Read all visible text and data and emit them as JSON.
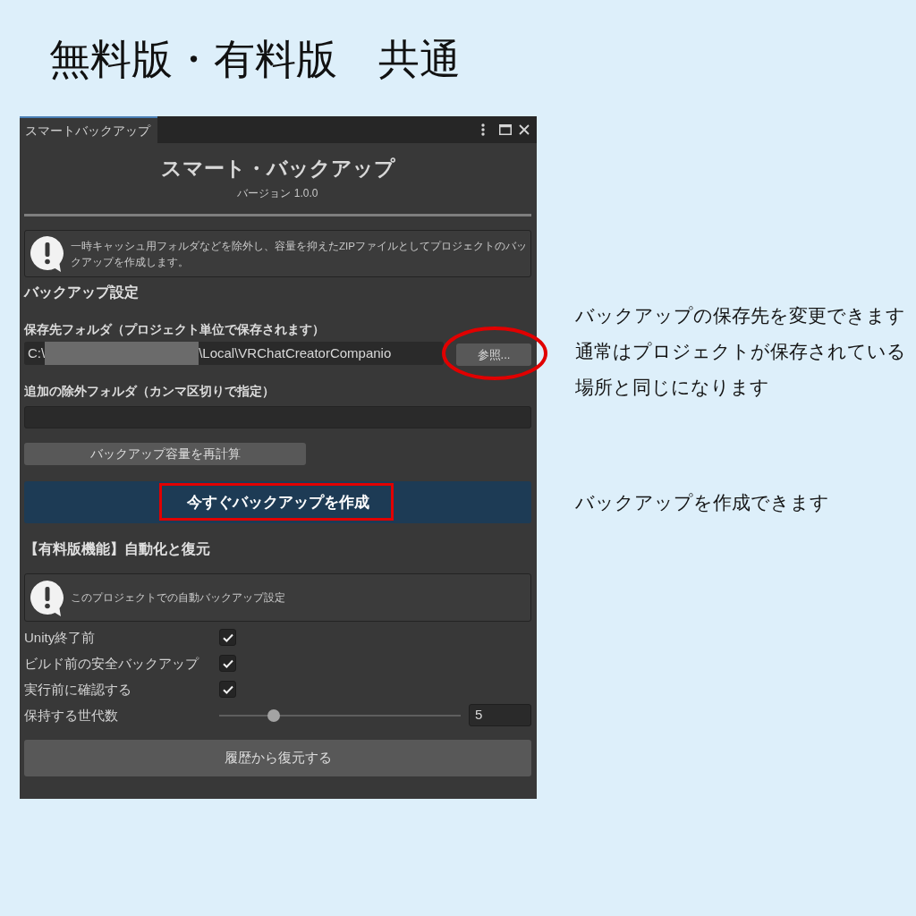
{
  "heading": "無料版・有料版　共通",
  "window": {
    "tabs": [
      {
        "label": "スマートバックアップ",
        "selected": true
      }
    ],
    "title": "スマート・バックアップ",
    "version": "バージョン 1.0.0"
  },
  "intro_notice": "一時キャッシュ用フォルダなどを除外し、容量を抑えたZIPファイルとしてプロジェクトのバックアップを作成します。",
  "backup_settings": {
    "heading": "バックアップ設定",
    "folder_label": "保存先フォルダ（プロジェクト単位で保存されます）",
    "folder_path": {
      "prefix": "C:\\",
      "redacted": true,
      "suffix": "\\Local\\VRChatCreatorCompanio"
    },
    "browse_button": {
      "label": "参照...",
      "circled": true
    },
    "exclude_label": "追加の除外フォルダ（カンマ区切りで指定）",
    "recalc_button": {
      "label": "バックアップ容量を再計算"
    },
    "create_button": {
      "label": "今すぐバックアップを作成",
      "boxed": true
    }
  },
  "pro_features": {
    "heading": "【有料版機能】自動化と復元",
    "notice": "このプロジェクトでの自動バックアップ設定",
    "options": [
      {
        "kind": "checkbox",
        "label": "Unity終了前",
        "checked": true
      },
      {
        "kind": "checkbox",
        "label": "ビルド前の安全バックアップ",
        "checked": true
      },
      {
        "kind": "checkbox",
        "label": "実行前に確認する",
        "checked": true
      },
      {
        "kind": "slider",
        "label": "保持する世代数",
        "level": 0.21,
        "value": "5"
      }
    ],
    "restore_button": {
      "label": "履歴から復元する"
    }
  },
  "notes": [
    {
      "lines": [
        "バックアップの保存先を変更できます",
        "通常はプロジェクトが保存されている",
        "場所と同じになります"
      ]
    },
    {
      "lines": [
        "バックアップを作成できます"
      ]
    }
  ]
}
